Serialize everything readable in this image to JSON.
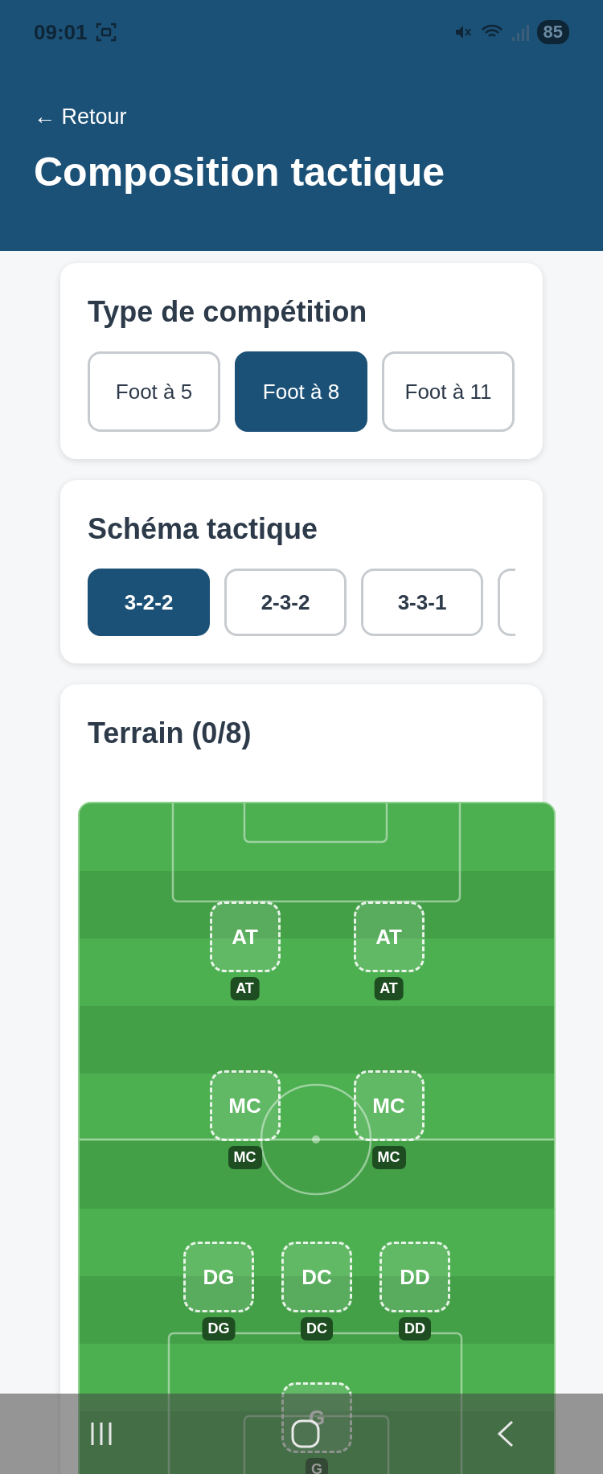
{
  "status_bar": {
    "time": "09:01",
    "battery": "85"
  },
  "header": {
    "back": "← Retour",
    "title": "Composition tactique"
  },
  "competition": {
    "title": "Type de compétition",
    "options": [
      {
        "label": "Foot à 5",
        "selected": false
      },
      {
        "label": "Foot à 8",
        "selected": true
      },
      {
        "label": "Foot à 11",
        "selected": false
      }
    ]
  },
  "scheme": {
    "title": "Schéma tactique",
    "options": [
      {
        "label": "3-2-2",
        "selected": true
      },
      {
        "label": "2-3-2",
        "selected": false
      },
      {
        "label": "3-3-1",
        "selected": false
      },
      {
        "selected": false
      }
    ]
  },
  "field": {
    "title": "Terrain (0/8)",
    "lines": [
      {
        "players": [
          {
            "slot": "AT",
            "badge": "AT"
          },
          {
            "slot": "AT",
            "badge": "AT"
          }
        ]
      },
      {
        "players": [
          {
            "slot": "MC",
            "badge": "MC"
          },
          {
            "slot": "MC",
            "badge": "MC"
          }
        ]
      },
      {
        "players": [
          {
            "slot": "DG",
            "badge": "DG"
          },
          {
            "slot": "DC",
            "badge": "DC"
          },
          {
            "slot": "DD",
            "badge": "DD"
          }
        ]
      },
      {
        "players": [
          {
            "slot": "G",
            "badge": "G"
          }
        ]
      }
    ]
  }
}
